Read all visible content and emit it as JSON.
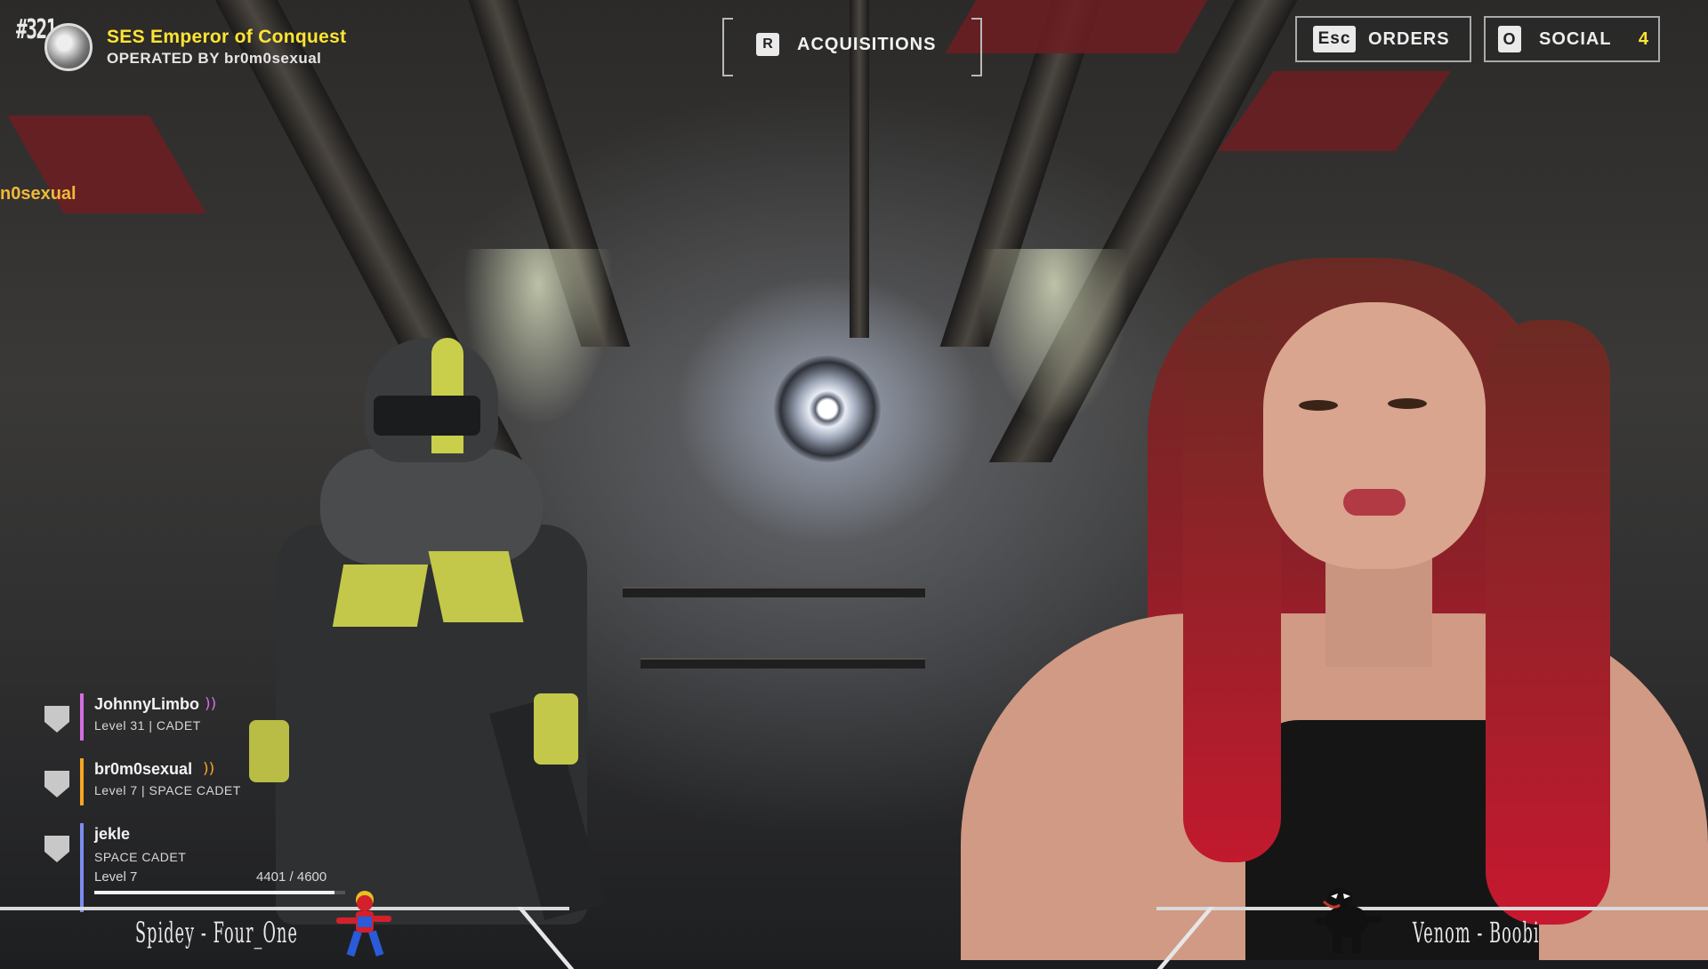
{
  "ship": {
    "number": "#321",
    "name": "SES Emperor of Conquest",
    "operated_by": "OPERATED BY br0m0sexual"
  },
  "side_name_fragment": "n0sexual",
  "acquisitions": {
    "key": "R",
    "label": "ACQUISITIONS"
  },
  "orders": {
    "key": "Esc",
    "label": "ORDERS"
  },
  "social": {
    "key": "O",
    "label": "SOCIAL",
    "count": "4"
  },
  "roster": [
    {
      "name": "JohnnyLimbo",
      "info": "Level 31 | CADET",
      "bar_color": "#d46ee0",
      "voice": true
    },
    {
      "name": "br0m0sexual",
      "info": "Level 7 | SPACE CADET",
      "bar_color": "#f5a623",
      "voice": true
    },
    {
      "name": "jekle",
      "rank": "SPACE CADET",
      "level": "Level 7",
      "xp": "4401 / 4600",
      "xp_fraction": 0.957,
      "bar_color": "#7c8cf0",
      "voice": false
    }
  ],
  "overlay": {
    "left_name": "Spidey - Four_One",
    "right_name": "Venom - Boobi"
  },
  "colors": {
    "accent_yellow": "#ffe433",
    "side_name_orange": "#f2b73b"
  }
}
